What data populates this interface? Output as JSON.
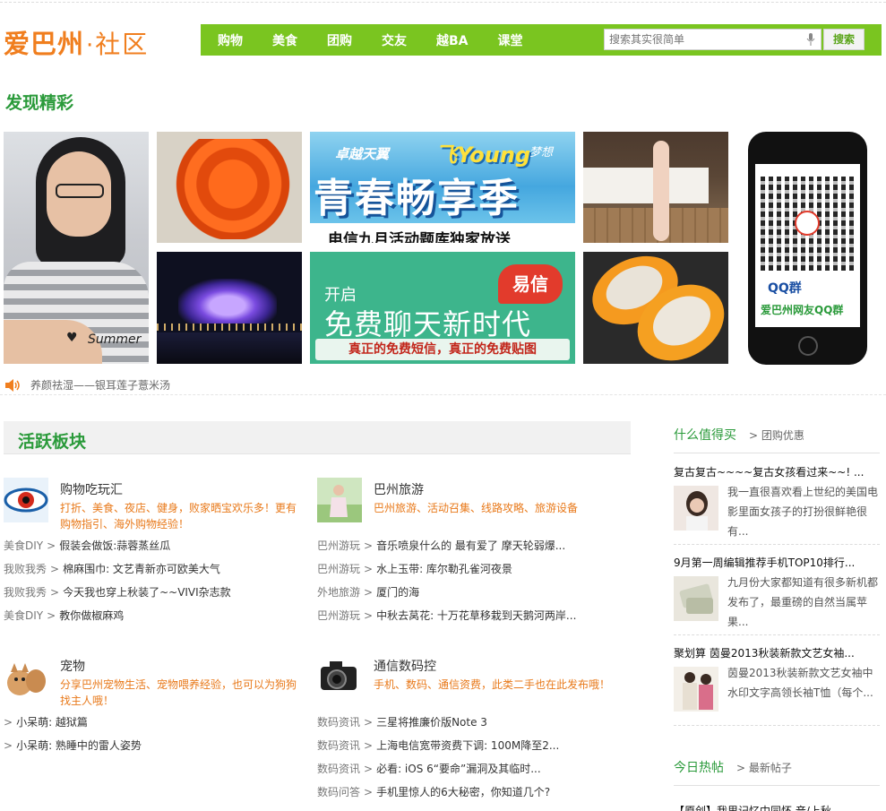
{
  "header": {
    "logo_main": "爱巴州",
    "logo_dot": "·",
    "logo_sub": "社区",
    "nav": [
      "购物",
      "美食",
      "团购",
      "交友",
      "越BA",
      "课堂"
    ],
    "search_placeholder": "搜索其实很简单",
    "search_button": "搜索"
  },
  "discover": {
    "title": "发现精彩",
    "banner1": {
      "slogan1": "卓越天翼",
      "slogan2": "飞Young",
      "slogan3": "梦想",
      "big": "青春畅享季",
      "caption": "电信九月活动题库独家放送"
    },
    "banner2": {
      "kai": "开启",
      "big": "免费聊天新时代",
      "tag": "易信",
      "bar": "真正的免费短信，真正的免费贴图"
    },
    "photo_caption": "Summer",
    "qq_label": "QQ群",
    "qq_name": "爱巴州网友QQ群"
  },
  "ticker": "养颜祛湿——银耳莲子薏米汤",
  "active_boards": {
    "title": "活跃板块",
    "boards": [
      {
        "name": "购物吃玩汇",
        "desc": "打折、美食、夜店、健身，败家晒宝欢乐多！更有购物指引、海外购物经验！",
        "posts": [
          {
            "cat": "美食DIY",
            "text": "假装会做饭:蒜蓉蒸丝瓜"
          },
          {
            "cat": "我败我秀",
            "text": "棉麻围巾: 文艺青新亦可欧美大气"
          },
          {
            "cat": "我败我秀",
            "text": "今天我也穿上秋装了~~VIVI杂志款"
          },
          {
            "cat": "美食DIY",
            "text": "教你做椒麻鸡"
          }
        ]
      },
      {
        "name": "巴州旅游",
        "desc": "巴州旅游、活动召集、线路攻略、旅游设备",
        "posts": [
          {
            "cat": "巴州游玩",
            "text": "音乐喷泉什么的 最有爱了 摩天轮弱爆..."
          },
          {
            "cat": "巴州游玩",
            "text": "水上玉带: 库尔勒孔雀河夜景"
          },
          {
            "cat": "外地旅游",
            "text": "厦门的海"
          },
          {
            "cat": "巴州游玩",
            "text": "中秋去莴花: 十万花草移栽到天鹅河两岸..."
          }
        ]
      },
      {
        "name": "宠物",
        "desc": "分享巴州宠物生活、宠物喂养经验，也可以为狗狗找主人哦！",
        "posts": [
          {
            "cat": "",
            "text": "小呆萌: 越狱篇"
          },
          {
            "cat": "",
            "text": "小呆萌: 熟睡中的雷人姿势"
          }
        ]
      },
      {
        "name": "通信数码控",
        "desc": "手机、数码、通信资费，此类二手也在此发布哦！",
        "posts": [
          {
            "cat": "数码资讯",
            "text": "三星将推廉价版Note 3"
          },
          {
            "cat": "数码资讯",
            "text": "上海电信宽带资费下调: 100M降至2..."
          },
          {
            "cat": "数码资讯",
            "text": "必看: iOS 6“要命”漏洞及其临时..."
          },
          {
            "cat": "数码问答",
            "text": "手机里惊人的6大秘密，你知道几个?"
          }
        ]
      }
    ]
  },
  "right": {
    "worth_buy": "什么值得买",
    "group_deal": "团购优惠",
    "items": [
      {
        "title": "复古复古~~~~复古女孩看过来~~! ...",
        "text": "我一直很喜欢看上世纪的美国电影里面女孩子的打扮很鲜艳很有..."
      },
      {
        "title": "9月第一周编辑推荐手机TOP10排行...",
        "text": "九月份大家都知道有很多新机都发布了，最重磅的自然当属苹果..."
      },
      {
        "title": "聚划算 茵曼2013秋装新款文艺女袖...",
        "text": "茵曼2013秋装新款文艺女袖中水印文字高领长袖T恤（每个..."
      }
    ],
    "hot_today": "今日热帖",
    "latest": "最新帖子",
    "partial": "【原创】我里记忆中同怀 音/上秋"
  },
  "colors": {
    "brand_orange": "#f07e1e",
    "nav_green": "#7ac520",
    "title_green": "#2a9a3a",
    "desc_orange": "#e8791a"
  }
}
